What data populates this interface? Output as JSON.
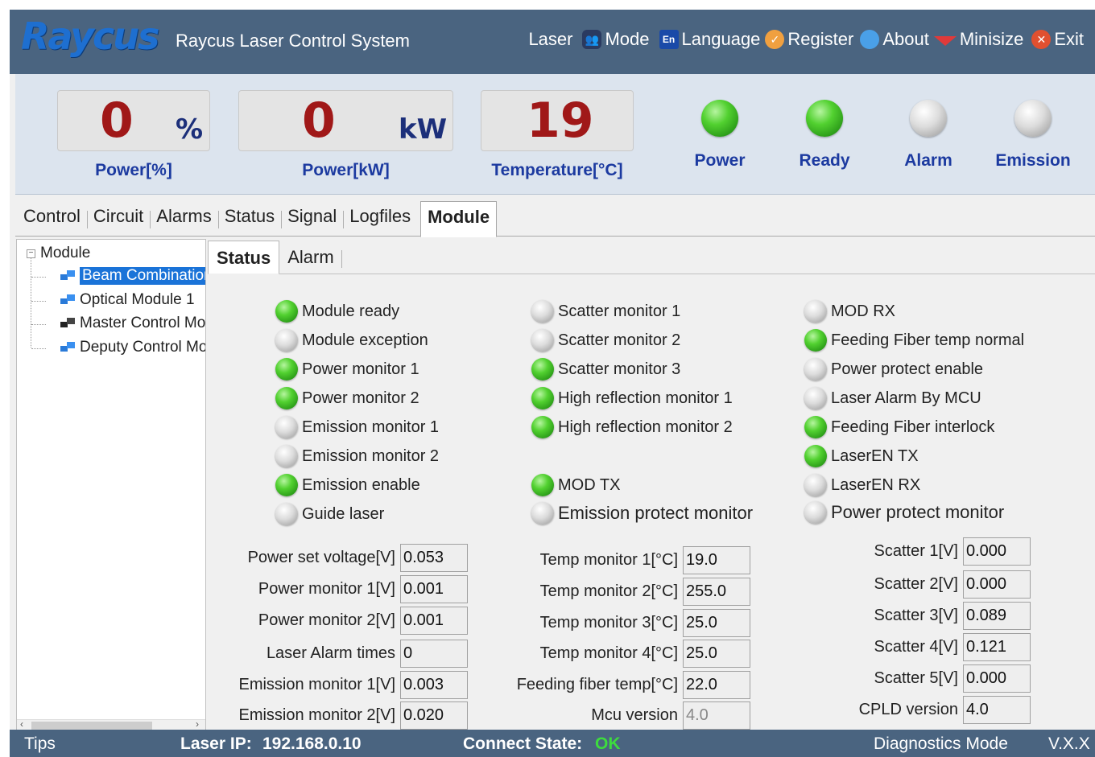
{
  "header": {
    "logo_text": "Raycus",
    "app_title": "Raycus Laser Control System",
    "menu": {
      "laser": "Laser",
      "mode": "Mode",
      "language": "Language",
      "register": "Register",
      "about": "About",
      "minisize": "Minisize",
      "exit": "Exit"
    }
  },
  "gauges": {
    "power_pct": {
      "value": "0",
      "unit": "%",
      "label": "Power[%]"
    },
    "power_kw": {
      "value": "0",
      "unit": "kW",
      "label": "Power[kW]"
    },
    "temperature": {
      "value": "19",
      "label": "Temperature[°C]"
    }
  },
  "indicators": [
    {
      "label": "Power",
      "state": "on"
    },
    {
      "label": "Ready",
      "state": "on"
    },
    {
      "label": "Alarm",
      "state": "off"
    },
    {
      "label": "Emission",
      "state": "off"
    }
  ],
  "main_tabs": [
    "Control",
    "Circuit",
    "Alarms",
    "Status",
    "Signal",
    "Logfiles",
    "Module"
  ],
  "main_tab_active": "Module",
  "tree": {
    "root": "Module",
    "items": [
      "Beam Combination Module",
      "Optical Module 1",
      "Master Control Module",
      "Deputy Control Module"
    ],
    "selected": "Beam Combination Module"
  },
  "sub_tabs": [
    "Status",
    "Alarm"
  ],
  "sub_tab_active": "Status",
  "status_flags": {
    "col1": [
      {
        "label": "Module ready",
        "state": "on"
      },
      {
        "label": "Module exception",
        "state": "off"
      },
      {
        "label": "Power monitor 1",
        "state": "on"
      },
      {
        "label": "Power monitor 2",
        "state": "on"
      },
      {
        "label": "Emission monitor 1",
        "state": "off"
      },
      {
        "label": "Emission monitor 2",
        "state": "off"
      },
      {
        "label": "Emission enable",
        "state": "on"
      },
      {
        "label": "Guide laser",
        "state": "off"
      }
    ],
    "col2": [
      {
        "label": "Scatter monitor 1",
        "state": "off"
      },
      {
        "label": "Scatter monitor 2",
        "state": "off"
      },
      {
        "label": "Scatter monitor 3",
        "state": "on"
      },
      {
        "label": "High reflection monitor 1",
        "state": "on"
      },
      {
        "label": "High reflection monitor 2",
        "state": "on"
      },
      {
        "label": "MOD TX",
        "state": "on"
      },
      {
        "label": "Emission protect monitor",
        "state": "off"
      }
    ],
    "col3": [
      {
        "label": "MOD RX",
        "state": "off"
      },
      {
        "label": "Feeding Fiber temp normal",
        "state": "on"
      },
      {
        "label": "Power protect enable",
        "state": "off"
      },
      {
        "label": "Laser Alarm By MCU",
        "state": "off"
      },
      {
        "label": "Feeding Fiber interlock",
        "state": "on"
      },
      {
        "label": "LaserEN TX",
        "state": "on"
      },
      {
        "label": "LaserEN RX",
        "state": "off"
      },
      {
        "label": "Power protect monitor",
        "state": "off"
      }
    ]
  },
  "fields": {
    "col1": [
      {
        "label": "Power set voltage[V]",
        "value": "0.053"
      },
      {
        "label": "Power monitor 1[V]",
        "value": "0.001"
      },
      {
        "label": "Power monitor 2[V]",
        "value": "0.001"
      },
      {
        "label": "Laser Alarm times",
        "value": "0"
      },
      {
        "label": "Emission monitor 1[V]",
        "value": "0.003"
      },
      {
        "label": "Emission monitor 2[V]",
        "value": "0.020"
      }
    ],
    "col2": [
      {
        "label": "Temp monitor 1[°C]",
        "value": "19.0"
      },
      {
        "label": "Temp monitor 2[°C]",
        "value": "255.0"
      },
      {
        "label": "Temp monitor 3[°C]",
        "value": "25.0"
      },
      {
        "label": "Temp monitor 4[°C]",
        "value": "25.0"
      },
      {
        "label": "Feeding fiber temp[°C]",
        "value": "22.0"
      },
      {
        "label": "Mcu version",
        "value": "4.0"
      }
    ],
    "col3": [
      {
        "label": "Scatter 1[V]",
        "value": "0.000"
      },
      {
        "label": "Scatter 2[V]",
        "value": "0.000"
      },
      {
        "label": "Scatter 3[V]",
        "value": "0.089"
      },
      {
        "label": "Scatter 4[V]",
        "value": "0.121"
      },
      {
        "label": "Scatter 5[V]",
        "value": "0.000"
      },
      {
        "label": "CPLD version",
        "value": "4.0"
      }
    ]
  },
  "statusbar": {
    "tips": "Tips",
    "laser_ip_label": "Laser IP:",
    "laser_ip": "192.168.0.10",
    "connect_label": "Connect State:",
    "connect_value": "OK",
    "mode": "Diagnostics Mode",
    "version": "V.X.X"
  },
  "colors": {
    "header_bg": "#4a6480",
    "gauge_value": "#a01818",
    "label_blue": "#1c3aa0",
    "led_on": "#52d130",
    "led_off": "#c8c8c8",
    "connect_ok": "#3ddc3d",
    "tree_selected": "#1a73d8"
  },
  "icons": {
    "mode": "users-icon",
    "language": "en-language-icon",
    "register": "key-icon",
    "about": "info-globe-icon",
    "minisize": "minimize-triangle-icon",
    "exit": "close-x-icon"
  }
}
